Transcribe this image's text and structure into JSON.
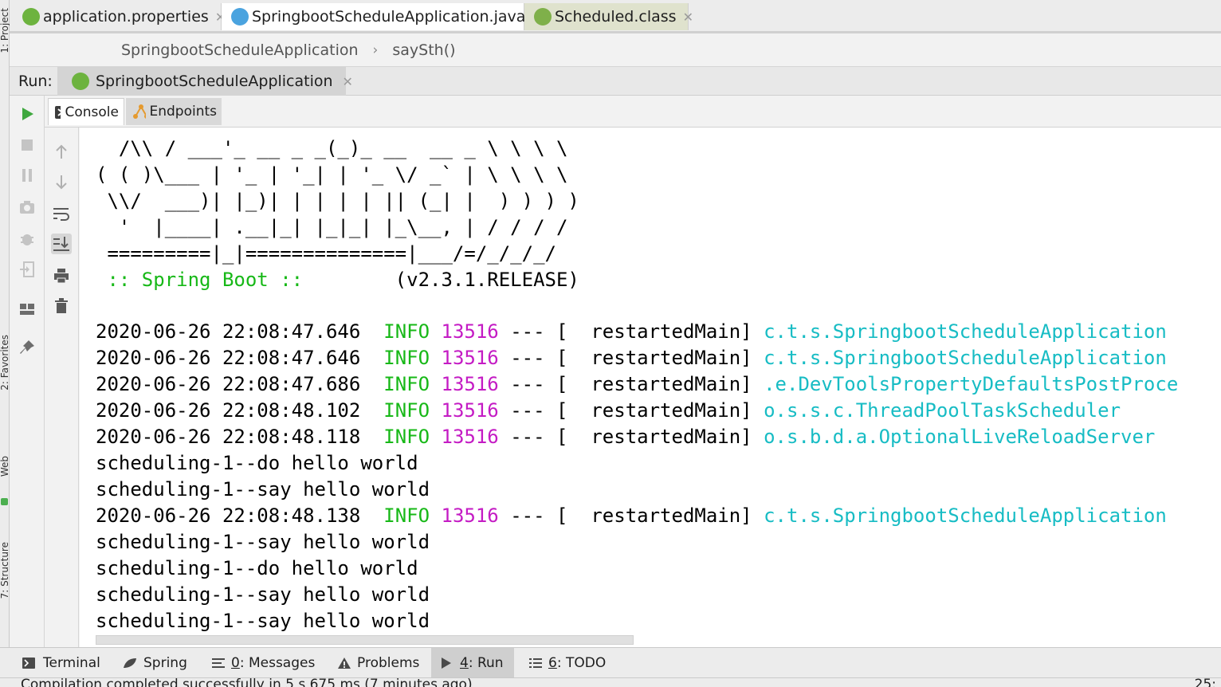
{
  "left_stripe": {
    "project_label": "1: Project",
    "favorites_label": "2: Favorites",
    "web_label": "Web",
    "structure_label": "7: Structure"
  },
  "editor_tabs": [
    {
      "label": "application.properties",
      "icon": "spring-leaf-icon",
      "active": false
    },
    {
      "label": "SpringbootScheduleApplication.java",
      "icon": "java-class-icon",
      "active": true
    },
    {
      "label": "Scheduled.class",
      "icon": "annotation-icon",
      "active": false
    }
  ],
  "breadcrumb": {
    "class_name": "SpringbootScheduleApplication",
    "separator": "›",
    "method_name": "saySth()"
  },
  "run_panel": {
    "label": "Run:",
    "config_name": "SpringbootScheduleApplication",
    "sub_tabs": {
      "console": "Console",
      "endpoints": "Endpoints"
    }
  },
  "console": {
    "banner": [
      "  /\\\\ / ___'_ __ _ _(_)_ __  __ _ \\ \\ \\ \\",
      "( ( )\\___ | '_ | '_| | '_ \\/ _` | \\ \\ \\ \\",
      " \\\\/  ___)| |_)| | | | | || (_| |  ) ) ) )",
      "  '  |____| .__|_| |_|_| |_\\__, | / / / /",
      " =========|_|==============|___/=/_/_/_/"
    ],
    "boot_label": " :: Spring Boot ::       ",
    "boot_version": " (v2.3.1.RELEASE)",
    "log_lines": [
      {
        "time": "2020-06-26 22:08:47.646",
        "level": "INFO",
        "pid": "13516",
        "thread": " --- [  restartedMain] ",
        "logger": "c.t.s.SpringbootScheduleApplication"
      },
      {
        "time": "2020-06-26 22:08:47.646",
        "level": "INFO",
        "pid": "13516",
        "thread": " --- [  restartedMain] ",
        "logger": "c.t.s.SpringbootScheduleApplication"
      },
      {
        "time": "2020-06-26 22:08:47.686",
        "level": "INFO",
        "pid": "13516",
        "thread": " --- [  restartedMain] ",
        "logger": ".e.DevToolsPropertyDefaultsPostProce"
      },
      {
        "time": "2020-06-26 22:08:48.102",
        "level": "INFO",
        "pid": "13516",
        "thread": " --- [  restartedMain] ",
        "logger": "o.s.s.c.ThreadPoolTaskScheduler"
      },
      {
        "time": "2020-06-26 22:08:48.118",
        "level": "INFO",
        "pid": "13516",
        "thread": " --- [  restartedMain] ",
        "logger": "o.s.b.d.a.OptionalLiveReloadServer"
      }
    ],
    "output_1": [
      "scheduling-1--do hello world",
      "scheduling-1--say hello world"
    ],
    "log_line_after": {
      "time": "2020-06-26 22:08:48.138",
      "level": "INFO",
      "pid": "13516",
      "thread": " --- [  restartedMain] ",
      "logger": "c.t.s.SpringbootScheduleApplication"
    },
    "output_2": [
      "scheduling-1--say hello world",
      "scheduling-1--do hello world",
      "scheduling-1--say hello world",
      "scheduling-1--say hello world"
    ]
  },
  "bottom_tabs": [
    {
      "prefix": "",
      "mnemonic": "",
      "label": "Terminal",
      "icon": "terminal-icon"
    },
    {
      "prefix": "",
      "mnemonic": "",
      "label": "Spring",
      "icon": "spring-leaf-icon"
    },
    {
      "prefix": "",
      "mnemonic": "0",
      "label": ": Messages",
      "icon": "messages-icon"
    },
    {
      "prefix": "",
      "mnemonic": "",
      "label": "Problems",
      "icon": "warning-icon"
    },
    {
      "prefix": "",
      "mnemonic": "4",
      "label": ": Run",
      "icon": "run-icon"
    },
    {
      "prefix": "",
      "mnemonic": "6",
      "label": ": TODO",
      "icon": "todo-list-icon"
    }
  ],
  "status": {
    "message": "Compilation completed successfully in 5 s 675 ms (7 minutes ago)",
    "right": "25:"
  },
  "colors": {
    "info_green": "#17b817",
    "pid_magenta": "#c41bc4",
    "logger_cyan": "#17bcc4",
    "run_green": "#3fa83f"
  }
}
